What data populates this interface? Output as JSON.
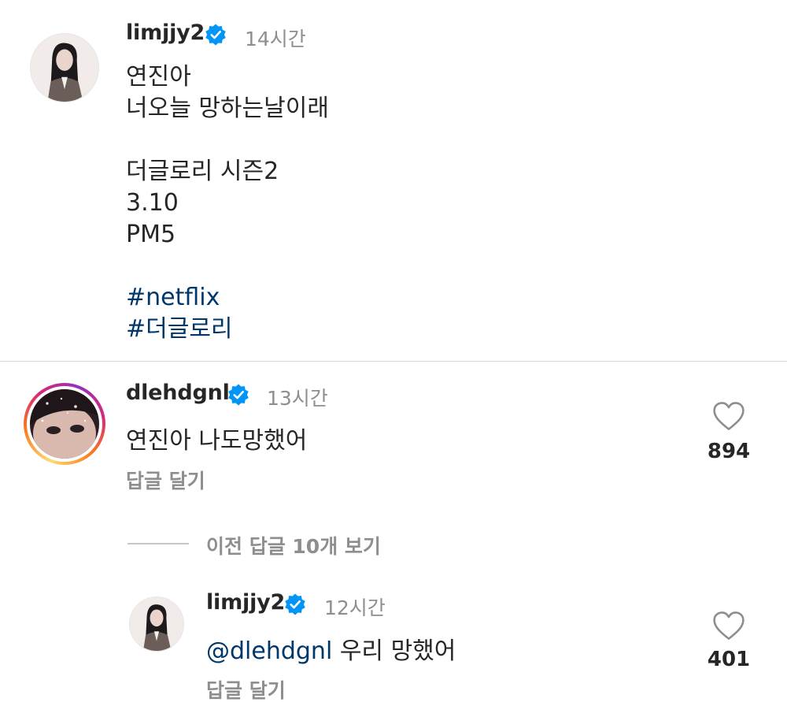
{
  "post": {
    "username": "limjjy2",
    "time": "14시간",
    "caption_lines": [
      "연진아",
      "너오늘 망하는날이래",
      "",
      "더글로리 시즌2",
      "3.10",
      "PM5",
      ""
    ],
    "hashtags": [
      "#netflix",
      "#더글로리"
    ]
  },
  "comment": {
    "username": "dlehdgnl",
    "time": "13시간",
    "text": "연진아 나도망했어",
    "reply_label": "답글 달기",
    "likes": "894"
  },
  "view_replies_label": "이전 답글 10개 보기",
  "reply": {
    "username": "limjjy2",
    "time": "12시간",
    "mention": "@dlehdgnl",
    "text": " 우리 망했어",
    "reply_label": "답글 달기",
    "likes": "401"
  },
  "icons": {
    "verified": "verified-badge-icon",
    "like": "heart-outline-icon"
  },
  "colors": {
    "verified_blue": "#0095f6",
    "link": "#00376b",
    "secondary_text": "#8e8e8e"
  }
}
